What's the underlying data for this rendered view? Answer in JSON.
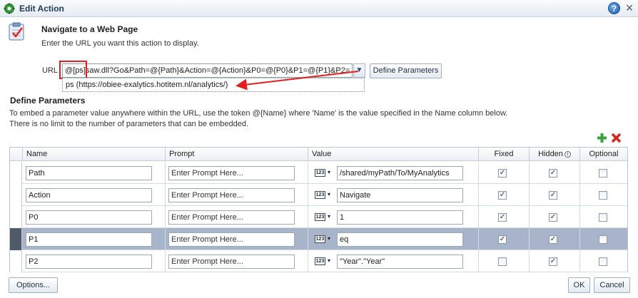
{
  "dialog": {
    "title": "Edit Action",
    "help_label": "?",
    "close_label": "×"
  },
  "action": {
    "heading": "Navigate to a Web Page",
    "instruction": "Enter the URL you want this action to display."
  },
  "url": {
    "label": "URL",
    "value": "@[ps]saw.dll?Go&Path=@{Path}&Action=@{Action}&P0=@{P0}&P1=@{P1}&P2=",
    "suggestion": "ps (https://obiee-exalytics.hotitem.nl/analytics/)",
    "define_button": "Define Parameters",
    "dropdown_glyph": "▼"
  },
  "params_section": {
    "title": "Define Parameters",
    "description_line1": "To embed a parameter value anywhere within the URL, use the token @{Name} where 'Name' is the value specified in the Name column below.",
    "description_line2": "There is no limit to the number of parameters that can be embedded."
  },
  "table": {
    "headers": {
      "name": "Name",
      "prompt": "Prompt",
      "value": "Value",
      "fixed": "Fixed",
      "hidden": "Hidden",
      "optional": "Optional"
    },
    "type_icon_text": "123",
    "type_arrow": "▾",
    "check_mark": "✓",
    "rows": [
      {
        "name": "Path",
        "prompt": "Enter Prompt Here...",
        "value": "/shared/myPath/To/MyAnalytics",
        "fixed": true,
        "hidden": true,
        "optional": false
      },
      {
        "name": "Action",
        "prompt": "Enter Prompt Here...",
        "value": "Navigate",
        "fixed": true,
        "hidden": true,
        "optional": false
      },
      {
        "name": "P0",
        "prompt": "Enter Prompt Here...",
        "value": "1",
        "fixed": true,
        "hidden": true,
        "optional": false
      },
      {
        "name": "P1",
        "prompt": "Enter Prompt Here...",
        "value": "eq",
        "fixed": true,
        "hidden": true,
        "optional": false
      },
      {
        "name": "P2",
        "prompt": "Enter Prompt Here...",
        "value": "\"Year\".\"Year\"",
        "fixed": false,
        "hidden": true,
        "optional": false
      }
    ],
    "selected_row": 3
  },
  "footer": {
    "options_label": "Options...",
    "ok_label": "OK",
    "cancel_label": "Cancel"
  },
  "colors": {
    "annotation_red": "#e31e1e",
    "selected_row": "#a8b4c9",
    "title_text": "#1d3a5c"
  }
}
